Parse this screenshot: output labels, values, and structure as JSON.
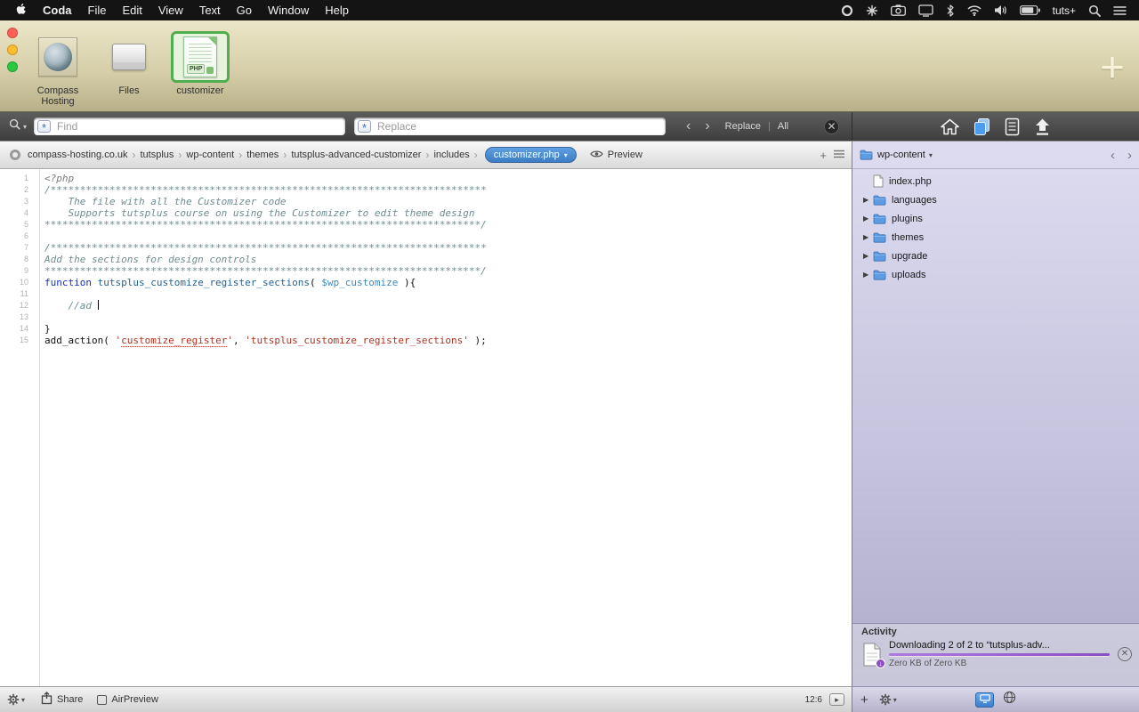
{
  "menu_bar": {
    "app_name": "Coda",
    "items": [
      "File",
      "Edit",
      "View",
      "Text",
      "Go",
      "Window",
      "Help"
    ],
    "status_icons": [
      "record",
      "flower",
      "camera",
      "display",
      "bluetooth",
      "wifi",
      "volume",
      "battery"
    ],
    "account_label": "tuts+",
    "trailing_icons": [
      "spotlight",
      "listmenu"
    ]
  },
  "tab_bar": {
    "sites": [
      {
        "label": "Compass Hosting",
        "icon": "globe-site",
        "selected": false
      },
      {
        "label": "Files",
        "icon": "files-drawer",
        "selected": false
      },
      {
        "label": "customizer",
        "icon": "php-file",
        "badge": "PHP",
        "selected": true
      }
    ],
    "add_site_label": "+"
  },
  "find_bar": {
    "find_placeholder": "Find",
    "replace_placeholder": "Replace",
    "prev_label": "‹",
    "next_label": "›",
    "replace_label": "Replace",
    "all_label": "All",
    "close_label": "✕"
  },
  "sidebar_toolbar": {
    "icons": [
      "home",
      "files",
      "clips",
      "publish"
    ],
    "active": "files"
  },
  "breadcrumb": {
    "path": [
      "compass-hosting.co.uk",
      "tutsplus",
      "wp-content",
      "themes",
      "tutsplus-advanced-customizer",
      "includes"
    ],
    "current_file": "customizer.php",
    "preview_label": "Preview",
    "add_label": "+"
  },
  "editor": {
    "lines": [
      {
        "n": 1,
        "seg": [
          [
            "<?php",
            "phptag"
          ]
        ]
      },
      {
        "n": 2,
        "seg": [
          [
            "/**************************************************************************",
            "comment"
          ]
        ]
      },
      {
        "n": 3,
        "seg": [
          [
            "    The file with all the Customizer code",
            "comment"
          ]
        ]
      },
      {
        "n": 4,
        "seg": [
          [
            "    Supports tutsplus course on using the Customizer to edit theme design",
            "comment"
          ]
        ]
      },
      {
        "n": 5,
        "seg": [
          [
            "**************************************************************************/",
            "comment"
          ]
        ]
      },
      {
        "n": 6,
        "seg": []
      },
      {
        "n": 7,
        "seg": [
          [
            "/**************************************************************************",
            "comment"
          ]
        ]
      },
      {
        "n": 8,
        "seg": [
          [
            "Add the sections for design controls",
            "comment"
          ]
        ]
      },
      {
        "n": 9,
        "seg": [
          [
            "**************************************************************************/",
            "comment"
          ]
        ]
      },
      {
        "n": 10,
        "seg": [
          [
            "function ",
            "keyword"
          ],
          [
            "tutsplus_customize_register_sections",
            "funcname"
          ],
          [
            "( ",
            "plain"
          ],
          [
            "$wp_customize",
            "variable"
          ],
          [
            " ){",
            "plain"
          ]
        ]
      },
      {
        "n": 11,
        "seg": []
      },
      {
        "n": 12,
        "seg": [
          [
            "    //ad ",
            "comment"
          ]
        ],
        "cursor": true
      },
      {
        "n": 13,
        "seg": []
      },
      {
        "n": 14,
        "seg": [
          [
            "}",
            "plain"
          ]
        ]
      },
      {
        "n": 15,
        "seg": [
          [
            "add_action( ",
            "plain"
          ],
          [
            "'",
            "string"
          ],
          [
            "customize_register",
            "string_misspell"
          ],
          [
            "'",
            "string"
          ],
          [
            ", ",
            "plain"
          ],
          [
            "'tutsplus_customize_register_sections'",
            "string"
          ],
          [
            " );",
            "plain"
          ]
        ]
      }
    ]
  },
  "sidebar": {
    "root_label": "wp-content",
    "items": [
      {
        "name": "index.php",
        "type": "file"
      },
      {
        "name": "languages",
        "type": "folder"
      },
      {
        "name": "plugins",
        "type": "folder"
      },
      {
        "name": "themes",
        "type": "folder"
      },
      {
        "name": "upgrade",
        "type": "folder"
      },
      {
        "name": "uploads",
        "type": "folder"
      }
    ],
    "activity": {
      "title": "Activity",
      "item_title": "Downloading 2 of 2 to “tutsplus-adv...",
      "item_sub": "Zero KB of Zero KB"
    }
  },
  "status_bar": {
    "share_label": "Share",
    "airpreview_label": "AirPreview",
    "cursor_position": "12:6"
  },
  "sidebar_status": {
    "add_label": "+"
  },
  "colors": {
    "accent_blue": "#4a90dd",
    "selection_green": "#4fae4f",
    "progress_purple": "#8a4fc0",
    "tab_bar_tan": "#d6cfa9",
    "sidebar_lavender": "#c6c4de"
  }
}
